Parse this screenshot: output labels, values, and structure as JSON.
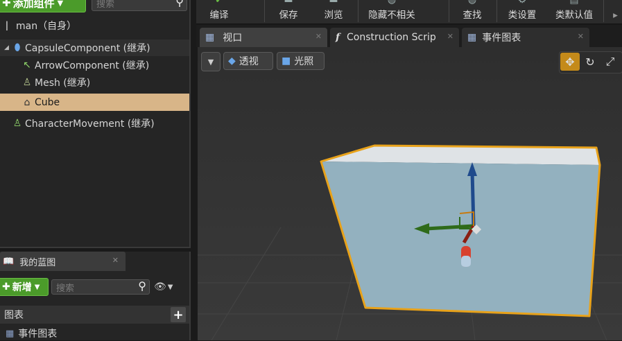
{
  "components_panel": {
    "add_component_label": "添加组件",
    "search_placeholder": "搜索",
    "self_label": "man（自身）",
    "tree": [
      {
        "label": "CapsuleComponent (继承)"
      },
      {
        "label": "ArrowComponent (继承)"
      },
      {
        "label": "Mesh (继承)"
      },
      {
        "label": "Cube",
        "selected": true
      },
      {
        "label": "CharacterMovement (继承)"
      }
    ]
  },
  "blueprint_panel": {
    "tab_label": "我的蓝图",
    "new_label": "新增",
    "search_placeholder": "搜索",
    "graphs_header": "图表",
    "event_graph_label": "事件图表"
  },
  "toolbar": {
    "buttons": [
      "编译",
      "保存",
      "浏览",
      "隐藏不相关",
      "查找",
      "类设置",
      "类默认值"
    ]
  },
  "tabs": [
    {
      "label": "视口",
      "active": true,
      "icon": "viewport-grid-icon"
    },
    {
      "label": "Construction Scrip",
      "active": false,
      "icon": "function-icon"
    },
    {
      "label": "事件图表",
      "active": false,
      "icon": "event-graph-icon"
    }
  ],
  "viewport": {
    "perspective_label": "透视",
    "lit_label": "光照",
    "active_transform_mode": "move"
  },
  "colors": {
    "accent_green": "#4b9b2a",
    "selection_highlight": "#d8b588",
    "selection_outline": "#e8a21a",
    "gizmo_active": "#c48a1a"
  }
}
